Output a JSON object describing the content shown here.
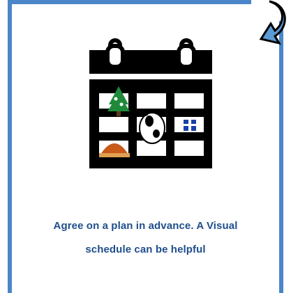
{
  "card": {
    "caption_line_1": "Agree on a plan in advance. A Visual",
    "caption_line_2": "schedule can be helpful"
  },
  "icons": {
    "calendar": "calendar-icon",
    "curl": "page-curl-arrow-icon",
    "tree": "christmas-tree-icon",
    "gift": "gift-icon",
    "turkey": "turkey-icon",
    "dog": "dog-icon"
  },
  "colors": {
    "frame": "#4a86c8",
    "text": "#1f4e8c",
    "calendar": "#000000"
  }
}
